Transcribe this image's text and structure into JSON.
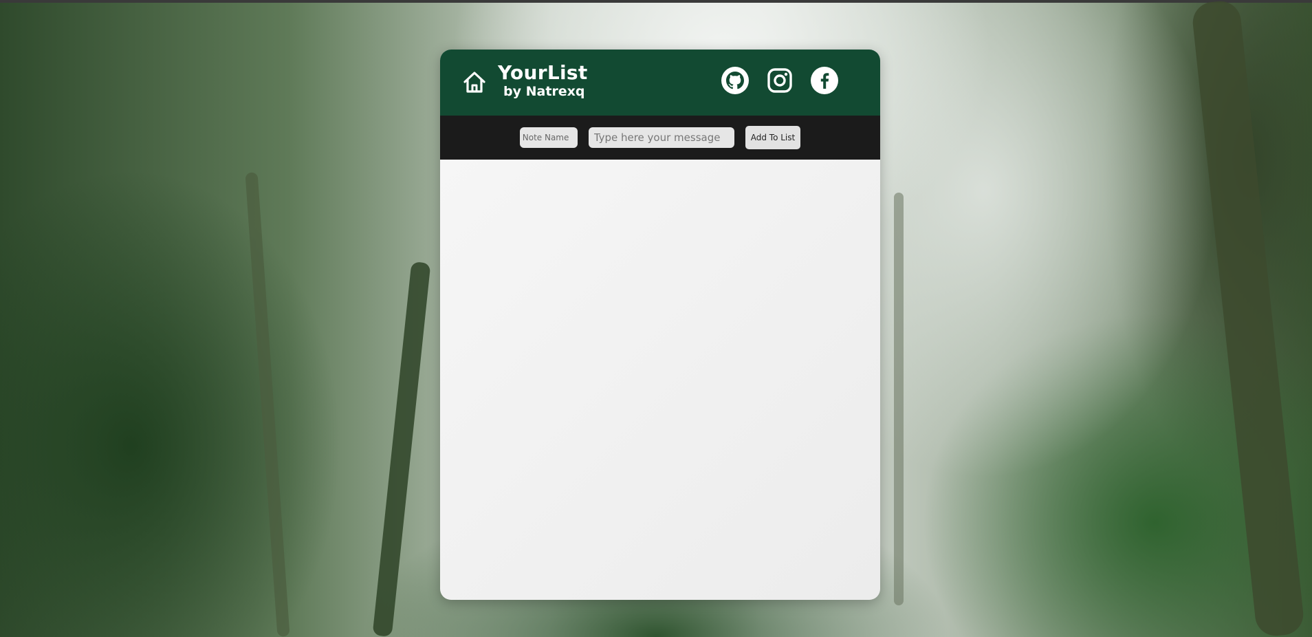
{
  "app": {
    "title": "YourList",
    "subtitle": "by Natrexq"
  },
  "header": {
    "icons": {
      "home": "home-icon",
      "github": "github-icon",
      "instagram": "instagram-icon",
      "facebook": "facebook-icon"
    },
    "colors": {
      "background": "#124a32",
      "text": "#ffffff"
    }
  },
  "form": {
    "note_name_placeholder": "Note Name",
    "note_name_value": "",
    "message_placeholder": "Type here your message",
    "message_value": "",
    "add_button_label": "Add To List"
  },
  "list": {
    "items": []
  },
  "colors": {
    "input_bar": "#1b1b1b",
    "card": "#f2f2f2"
  }
}
